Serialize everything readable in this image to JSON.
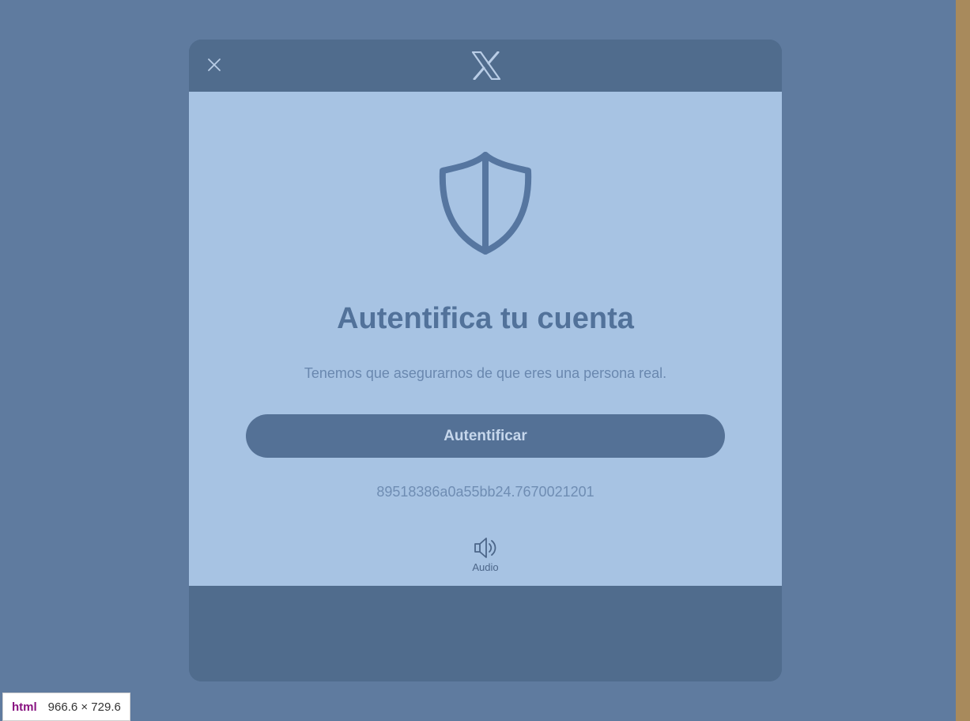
{
  "modal": {
    "title": "Autentifica tu cuenta",
    "subtitle": "Tenemos que asegurarnos de que eres una persona real.",
    "primary_button_label": "Autentificar",
    "session_id": "89518386a0a55bb24.7670021201",
    "audio_label": "Audio",
    "icons": {
      "close": "close-icon",
      "logo": "x-logo-icon",
      "shield": "shield-icon",
      "audio": "speaker-icon"
    }
  },
  "devtools_badge": {
    "tag": "html",
    "size": "966.6 × 729.6"
  },
  "colors": {
    "page_background": "#5f7b9f",
    "modal_header": "#506c8d",
    "modal_body": "#a7c3e3",
    "primary_button": "#547196",
    "accent_text": "#52729a",
    "right_strip": "#a88a5c"
  }
}
